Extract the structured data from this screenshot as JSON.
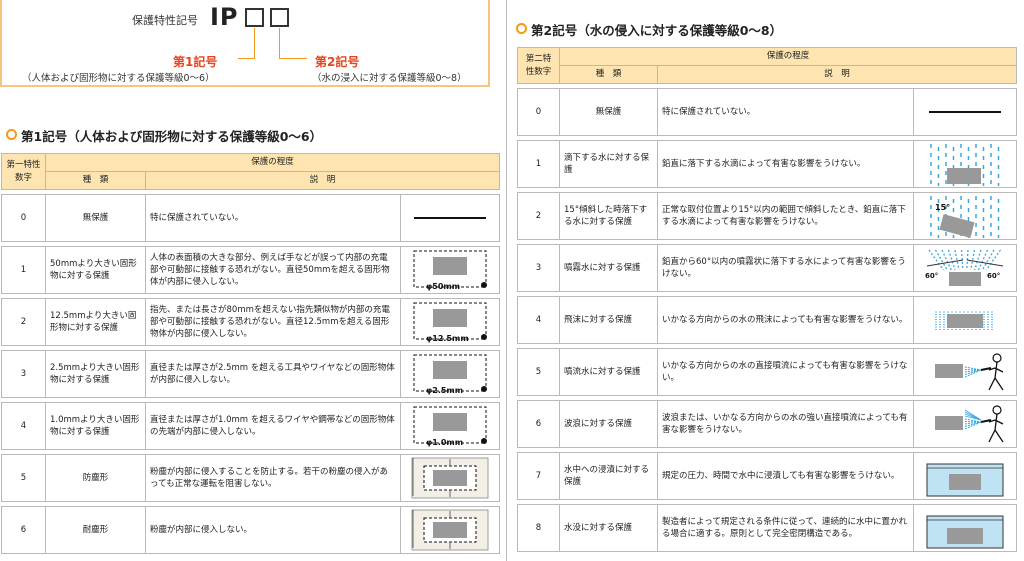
{
  "explain": {
    "label": "保護特性記号",
    "ip": "IP",
    "first_code": "第1記号",
    "first_desc": "（人体および固形物に対する保護等級0〜6）",
    "second_code": "第2記号",
    "second_desc": "（水の浸入に対する保護等級0〜8）"
  },
  "left": {
    "heading": "第1記号（人体および固形物に対する保護等級0〜6）",
    "hdr_grade": "第一特性数字",
    "hdr_degree": "保護の程度",
    "hdr_kind": "種　類",
    "hdr_desc": "説　明",
    "rows": [
      {
        "n": "0",
        "kind": "無保護",
        "center": true,
        "desc": "特に保護されていない。",
        "fig": "line"
      },
      {
        "n": "1",
        "kind": "50mmより大きい固形物に対する保護",
        "desc": "人体の表面積の大きな部分、例えば手などが誤って内部の充電部や可動部に接触する恐れがない。直径50mmを超える固形物体が内部に侵入しない。",
        "fig": "solid",
        "label": "φ50mm"
      },
      {
        "n": "2",
        "kind": "12.5mmより大きい固形物に対する保護",
        "desc": "指先、または長さが80mmを超えない指先類似物が内部の充電部や可動部に接触する恐れがない。直径12.5mmを超える固形物体が内部に侵入しない。",
        "fig": "solid",
        "label": "φ12.5mm"
      },
      {
        "n": "3",
        "kind": "2.5mmより大きい固形物に対する保護",
        "desc": "直径または厚さが2.5mm を超える工具やワイヤなどの固形物体が内部に侵入しない。",
        "fig": "solid",
        "label": "φ2.5mm"
      },
      {
        "n": "4",
        "kind": "1.0mmより大きい固形物に対する保護",
        "desc": "直径または厚さが1.0mm を超えるワイヤや鋼帯などの固形物体の先端が内部に侵入しない。",
        "fig": "solid",
        "label": "φ1.0mm"
      },
      {
        "n": "5",
        "kind": "防塵形",
        "center": true,
        "desc": "粉塵が内部に侵入することを防止する。若干の粉塵の侵入があっても正常な運転を阻害しない。",
        "fig": "dust"
      },
      {
        "n": "6",
        "kind": "耐塵形",
        "center": true,
        "desc": "粉塵が内部に侵入しない。",
        "fig": "dust"
      }
    ]
  },
  "right": {
    "heading": "第2記号（水の侵入に対する保護等級0〜8）",
    "hdr_grade": "第二特性数字",
    "hdr_degree": "保護の程度",
    "hdr_kind": "種　類",
    "hdr_desc": "説　明",
    "rows": [
      {
        "n": "0",
        "kind": "無保護",
        "center": true,
        "desc": "特に保護されていない。",
        "fig": "line"
      },
      {
        "n": "1",
        "kind": "滴下する水に対する保護",
        "desc": "鉛直に落下する水滴によって有害な影響をうけない。",
        "fig": "drip"
      },
      {
        "n": "2",
        "kind": "15°傾斜した時落下する水に対する保護",
        "desc": "正常な取付位置より15°以内の範囲で傾斜したとき、鉛直に落下する水滴によって有害な影響をうけない。",
        "fig": "tilt",
        "label": "15°"
      },
      {
        "n": "3",
        "kind": "噴霧水に対する保護",
        "desc": "鉛直から60°以内の噴霧状に落下する水によって有害な影響をうけない。",
        "fig": "spray",
        "label": "60°"
      },
      {
        "n": "4",
        "kind": "飛沫に対する保護",
        "desc": "いかなる方向からの水の飛沫によっても有害な影響をうけない。",
        "fig": "splash"
      },
      {
        "n": "5",
        "kind": "噴流水に対する保護",
        "desc": "いかなる方向からの水の直接噴流によっても有害な影響をうけない。",
        "fig": "jet"
      },
      {
        "n": "6",
        "kind": "波浪に対する保護",
        "desc": "波浪または、いかなる方向からの水の強い直接噴流によっても有害な影響をうけない。",
        "fig": "jet2"
      },
      {
        "n": "7",
        "kind": "水中への浸漬に対する保護",
        "desc": "規定の圧力、時間で水中に浸漬しても有害な影響をうけない。",
        "fig": "immerse"
      },
      {
        "n": "8",
        "kind": "水没に対する保護",
        "desc": "製造者によって規定される条件に従って、連続的に水中に置かれる場合に適する。原則として完全密閉構造である。",
        "fig": "submerge"
      }
    ]
  },
  "colors": {
    "header_bg": "#fde4b0",
    "accent": "#f39a1e",
    "code_red": "#e8431e",
    "water": "#3aa7dc",
    "box": "#999999"
  }
}
